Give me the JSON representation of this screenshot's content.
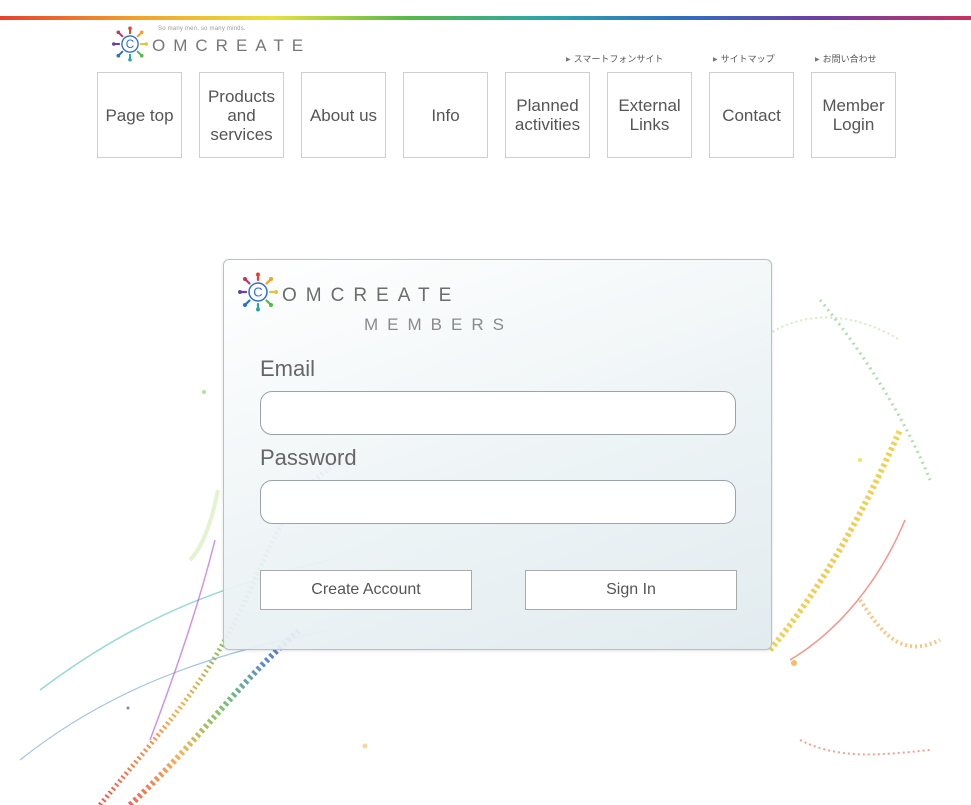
{
  "header": {
    "logo_tagline": "So many men, so many minds.",
    "logo_text": "OMCREATE",
    "util_links": [
      {
        "label": "スマートフォンサイト"
      },
      {
        "label": "サイトマップ"
      },
      {
        "label": "お問い合わせ"
      }
    ],
    "nav": [
      {
        "label": "Page top"
      },
      {
        "label": "Products and services"
      },
      {
        "label": "About us"
      },
      {
        "label": "Info"
      },
      {
        "label": "Planned activities"
      },
      {
        "label": "External Links"
      },
      {
        "label": "Contact"
      },
      {
        "label": "Member Login"
      }
    ]
  },
  "login": {
    "logo_text": "OMCREATE",
    "logo_sub": "MEMBERS",
    "email_label": "Email",
    "email_value": "",
    "password_label": "Password",
    "password_value": "",
    "create_account_label": "Create Account",
    "sign_in_label": "Sign In"
  },
  "colors": {
    "accent_rainbow": [
      "#e8402c",
      "#f2a12a",
      "#e9e23a",
      "#56b947",
      "#2aa7a8",
      "#2f6fc2",
      "#6a3fa8",
      "#c8325f"
    ],
    "card_border": "#b9c1c4",
    "text": "#555555"
  },
  "icons": {
    "logo_mark": "rainbow-c-icon",
    "util_link_marker": "triangle-right-icon"
  }
}
